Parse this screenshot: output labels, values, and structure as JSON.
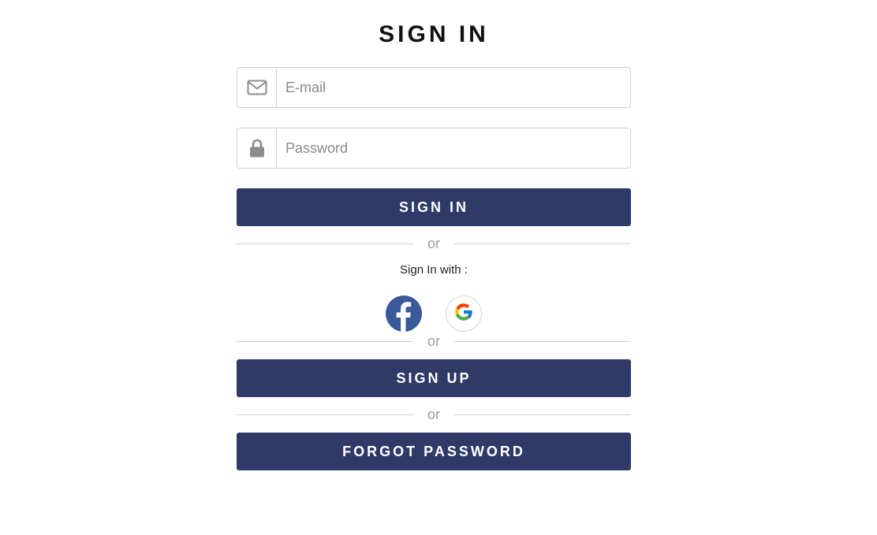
{
  "page": {
    "title": "SIGN IN"
  },
  "form": {
    "email": {
      "placeholder": "E-mail",
      "icon": "envelope-icon"
    },
    "password": {
      "placeholder": "Password",
      "icon": "lock-icon"
    },
    "signin_button": "SIGN IN",
    "divider_text": "or",
    "signin_with_label": "Sign In with :",
    "social": [
      {
        "name": "facebook",
        "icon": "facebook-icon",
        "color": "#3b5998"
      },
      {
        "name": "google",
        "icon": "google-icon"
      }
    ],
    "signup_button": "SIGN UP",
    "forgot_button": "FORGOT PASSWORD"
  },
  "colors": {
    "button_bg": "#2f3a68",
    "button_text": "#ffffff",
    "border": "#d2d2d2"
  }
}
